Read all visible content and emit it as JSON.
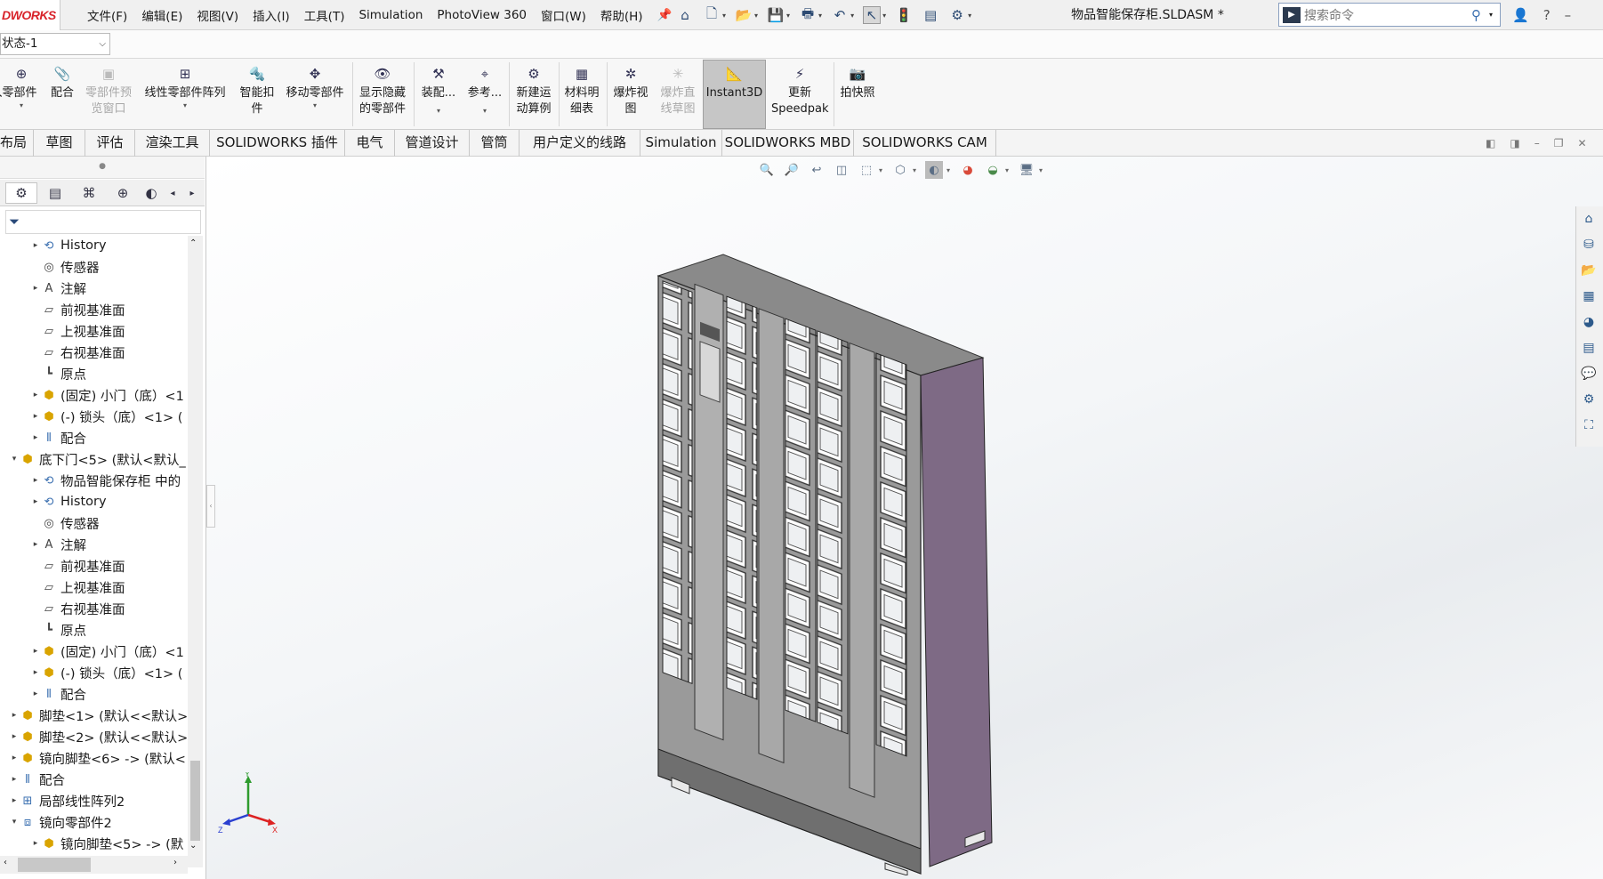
{
  "titlebar": {
    "logo": "DWORKS",
    "menus": [
      "文件(F)",
      "编辑(E)",
      "视图(V)",
      "插入(I)",
      "工具(T)",
      "Simulation",
      "PhotoView 360",
      "窗口(W)",
      "帮助(H)"
    ],
    "doc_title": "物品智能保存柜.SLDASM *",
    "search_placeholder": "搜索命令"
  },
  "config": {
    "value": "状态-1"
  },
  "commands": [
    {
      "label": "插入零部件",
      "icon": "insert-component-icon"
    },
    {
      "label": "配合",
      "icon": "mate-icon"
    },
    {
      "label": "零部件预览窗口",
      "icon": "component-preview-icon",
      "disabled": true
    },
    {
      "label": "线性零部件阵列",
      "icon": "linear-pattern-icon"
    },
    {
      "label": "智能扣件",
      "icon": "smart-fastener-icon"
    },
    {
      "label": "移动零部件",
      "icon": "move-component-icon"
    },
    {
      "label": "显示隐藏的零部件",
      "icon": "show-hidden-icon"
    },
    {
      "label": "装配...",
      "icon": "assembly-features-icon"
    },
    {
      "label": "参考...",
      "icon": "reference-geometry-icon"
    },
    {
      "label": "新建运动算例",
      "icon": "motion-study-icon"
    },
    {
      "label": "材料明细表",
      "icon": "bom-icon"
    },
    {
      "label": "爆炸视图",
      "icon": "exploded-view-icon"
    },
    {
      "label": "爆炸直线草图",
      "icon": "explode-line-icon",
      "disabled": true
    },
    {
      "label": "Instant3D",
      "icon": "instant3d-icon",
      "active": true
    },
    {
      "label": "更新Speedpak",
      "icon": "speedpak-icon"
    },
    {
      "label": "拍快照",
      "icon": "snapshot-icon"
    }
  ],
  "tabs": [
    "布局",
    "草图",
    "评估",
    "渲染工具",
    "SOLIDWORKS 插件",
    "电气",
    "管道设计",
    "管筒",
    "用户定义的线路",
    "Simulation",
    "SOLIDWORKS MBD",
    "SOLIDWORKS CAM"
  ],
  "tree": [
    {
      "label": "History",
      "icon": "history-icon",
      "toggle": "▸"
    },
    {
      "label": "传感器",
      "icon": "sensor-icon",
      "toggle": ""
    },
    {
      "label": "注解",
      "icon": "annotation-icon",
      "toggle": "▸"
    },
    {
      "label": "前视基准面",
      "icon": "plane-icon",
      "toggle": ""
    },
    {
      "label": "上视基准面",
      "icon": "plane-icon",
      "toggle": ""
    },
    {
      "label": "右视基准面",
      "icon": "plane-icon",
      "toggle": ""
    },
    {
      "label": "原点",
      "icon": "origin-icon",
      "toggle": ""
    },
    {
      "label": "(固定) 小门（底）<1",
      "icon": "part-icon",
      "toggle": "▸"
    },
    {
      "label": "(-) 锁头（底）<1> (",
      "icon": "part-icon",
      "toggle": "▸"
    },
    {
      "label": "配合",
      "icon": "mates-icon",
      "toggle": "▸"
    },
    {
      "label": "底下门<5> (默认<默认_",
      "icon": "assembly-icon",
      "toggle": "▾"
    },
    {
      "label": "物品智能保存柜 中的",
      "icon": "history-icon",
      "toggle": "▸"
    },
    {
      "label": "History",
      "icon": "history-icon",
      "toggle": "▸"
    },
    {
      "label": "传感器",
      "icon": "sensor-icon",
      "toggle": ""
    },
    {
      "label": "注解",
      "icon": "annotation-icon",
      "toggle": "▸"
    },
    {
      "label": "前视基准面",
      "icon": "plane-icon",
      "toggle": ""
    },
    {
      "label": "上视基准面",
      "icon": "plane-icon",
      "toggle": ""
    },
    {
      "label": "右视基准面",
      "icon": "plane-icon",
      "toggle": ""
    },
    {
      "label": "原点",
      "icon": "origin-icon",
      "toggle": ""
    },
    {
      "label": "(固定) 小门（底）<1",
      "icon": "part-icon",
      "toggle": "▸"
    },
    {
      "label": "(-) 锁头（底）<1> (",
      "icon": "part-icon",
      "toggle": "▸"
    },
    {
      "label": "配合",
      "icon": "mates-icon",
      "toggle": "▸"
    },
    {
      "label": "脚垫<1> (默认<<默认>",
      "icon": "part-icon",
      "toggle": "▸"
    },
    {
      "label": "脚垫<2> (默认<<默认>",
      "icon": "part-icon",
      "toggle": "▸"
    },
    {
      "label": "镜向脚垫<6> -> (默认<",
      "icon": "part-icon",
      "toggle": "▸"
    },
    {
      "label": "配合",
      "icon": "mates-icon",
      "toggle": "▸"
    },
    {
      "label": "局部线性阵列2",
      "icon": "pattern-icon",
      "toggle": "▸"
    },
    {
      "label": "镜向零部件2",
      "icon": "mirror-icon",
      "toggle": "▾"
    },
    {
      "label": "镜向脚垫<5> -> (默",
      "icon": "part-icon",
      "toggle": "▸"
    }
  ],
  "triad": {
    "x": "X",
    "y": "Y",
    "z": "Z"
  },
  "colors": {
    "accent": "#d8232a",
    "side_panel": "#7e6a85"
  }
}
